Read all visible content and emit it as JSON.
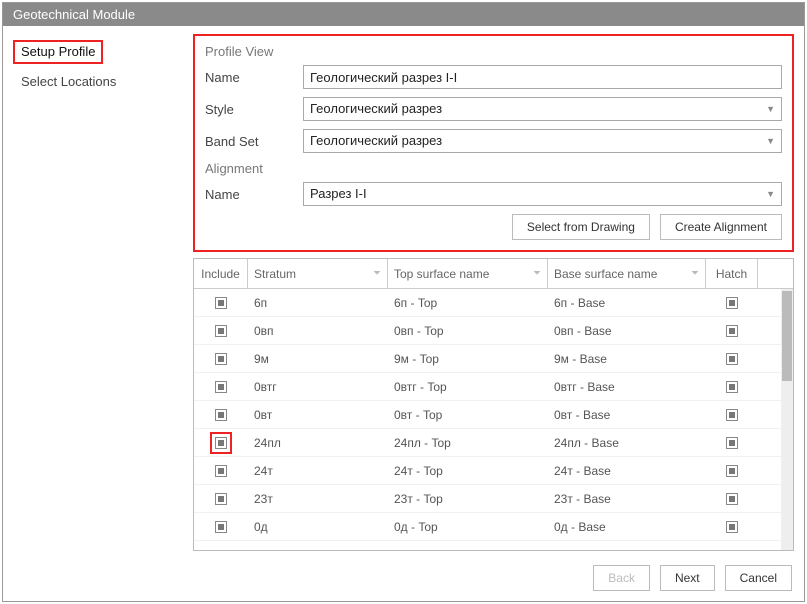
{
  "window": {
    "title": "Geotechnical Module"
  },
  "sidebar": {
    "items": [
      {
        "label": "Setup Profile"
      },
      {
        "label": "Select Locations"
      }
    ],
    "active": 0
  },
  "profileView": {
    "heading": "Profile View",
    "nameLabel": "Name",
    "nameValue": "Геологический разрез I-I",
    "styleLabel": "Style",
    "styleValue": "Геологический разрез",
    "bandSetLabel": "Band Set",
    "bandSetValue": "Геологический разрез"
  },
  "alignment": {
    "heading": "Alignment",
    "nameLabel": "Name",
    "nameValue": "Разрез I-I",
    "selectFromDrawing": "Select from Drawing",
    "createAlignment": "Create Alignment"
  },
  "table": {
    "headers": {
      "include": "Include",
      "stratum": "Stratum",
      "top": "Top surface name",
      "base": "Base surface name",
      "hatch": "Hatch"
    },
    "rows": [
      {
        "stratum": "6п",
        "top": "6п - Top",
        "base": "6п - Base"
      },
      {
        "stratum": "0вп",
        "top": "0вп - Top",
        "base": "0вп - Base"
      },
      {
        "stratum": "9м",
        "top": "9м - Top",
        "base": "9м - Base"
      },
      {
        "stratum": "0втг",
        "top": "0втг - Top",
        "base": "0втг - Base"
      },
      {
        "stratum": "0вт",
        "top": "0вт - Top",
        "base": "0вт - Base"
      },
      {
        "stratum": "24пл",
        "top": "24пл - Top",
        "base": "24пл - Base"
      },
      {
        "stratum": "24т",
        "top": "24т - Top",
        "base": "24т - Base"
      },
      {
        "stratum": "23т",
        "top": "23т - Top",
        "base": "23т - Base"
      },
      {
        "stratum": "0д",
        "top": "0д - Top",
        "base": "0д - Base"
      }
    ],
    "highlightRow": 5
  },
  "footer": {
    "back": "Back",
    "next": "Next",
    "cancel": "Cancel"
  }
}
